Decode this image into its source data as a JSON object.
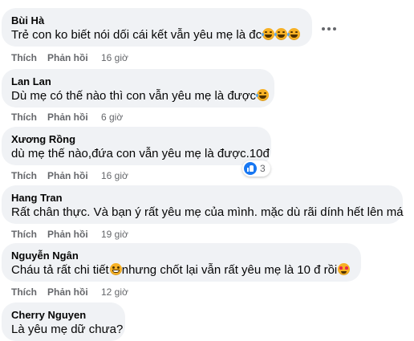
{
  "comments": [
    {
      "author": "Bùi Hà",
      "text": "Trẻ con ko biết nói dối cái kết vẫn yêu mẹ là đc",
      "emojis": [
        "rolling-laughing",
        "rolling-laughing",
        "rolling-laughing"
      ],
      "like_label": "Thích",
      "reply_label": "Phản hồi",
      "time": "16 giờ"
    },
    {
      "author": "Lan Lan",
      "text": "Dù mẹ có thế nào thì con vẫn yêu mẹ là được",
      "emojis": [
        "laughing-tears"
      ],
      "like_label": "Thích",
      "reply_label": "Phản hồi",
      "time": "6 giờ"
    },
    {
      "author": "Xương Rồng",
      "text": "dù mẹ thế nào,đứa con vẫn yêu mẹ là được.10đ",
      "reaction_count": "3",
      "like_label": "Thích",
      "reply_label": "Phản hồi",
      "time": "16 giờ"
    },
    {
      "author": "Hang Tran",
      "text": "Rất chân thực. Và bạn ý rất yêu mẹ của mình. mặc dù rãi dính hết lên má",
      "like_label": "Thích",
      "reply_label": "Phản hồi",
      "time": "19 giờ"
    },
    {
      "author": "Nguyễn Ngân",
      "text_before": "Cháu tả rất chi tiết",
      "text_after": "nhưng chốt lại vẫn rất yêu mẹ là 10 đ rồi",
      "emojis": [
        "grinning",
        "heart-eyes"
      ],
      "like_label": "Thích",
      "reply_label": "Phản hồi",
      "time": "12 giờ"
    },
    {
      "author": "Cherry Nguyen",
      "text": "Là yêu mẹ dữ chưa?"
    }
  ],
  "icons": {
    "more": "more-horizontal-icon",
    "reaction": "like-reaction-icon",
    "like_color": "#1877f2",
    "bubble_color": "#f0f2f5",
    "meta_color": "#65676b"
  }
}
